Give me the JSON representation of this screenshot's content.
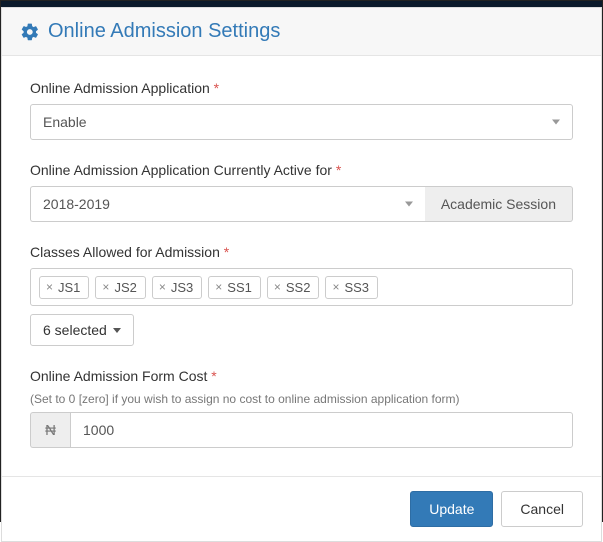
{
  "header": {
    "title": "Online Admission Settings"
  },
  "form": {
    "admission_application": {
      "label": "Online Admission Application",
      "required_mark": "*",
      "value": "Enable"
    },
    "active_for": {
      "label": "Online Admission Application Currently Active for",
      "required_mark": "*",
      "value": "2018-2019",
      "addon": "Academic Session"
    },
    "classes": {
      "label": "Classes Allowed for Admission",
      "required_mark": "*",
      "tags": [
        "JS1",
        "JS2",
        "JS3",
        "SS1",
        "SS2",
        "SS3"
      ],
      "summary": "6 selected"
    },
    "cost": {
      "label": "Online Admission Form Cost",
      "required_mark": "*",
      "hint": "(Set to 0 [zero] if you wish to assign no cost to online admission application form)",
      "currency": "₦",
      "value": "1000"
    }
  },
  "actions": {
    "update": "Update",
    "cancel": "Cancel"
  }
}
